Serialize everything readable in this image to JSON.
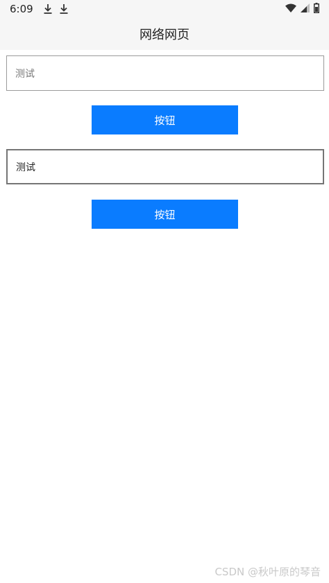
{
  "status_bar": {
    "time": "6:09",
    "icons": [
      "download-icon",
      "download-icon",
      "wifi-icon",
      "signal-icon",
      "battery-icon"
    ]
  },
  "app_bar": {
    "title": "网络网页"
  },
  "form": {
    "input_1": {
      "placeholder": "测试"
    },
    "button_1": {
      "label": "按钮"
    },
    "input_2": {
      "value": "测试"
    },
    "button_2": {
      "label": "按钮"
    }
  },
  "watermark": {
    "text": "CSDN @秋叶原的琴音"
  },
  "colors": {
    "button": "#0a7cff",
    "button_text": "#ffffff",
    "bar_background": "#f6f6f6"
  }
}
